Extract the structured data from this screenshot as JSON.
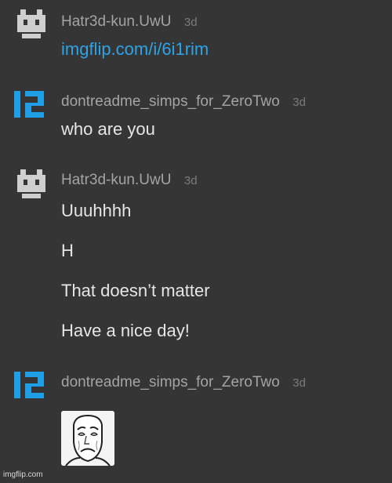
{
  "comments": [
    {
      "username": "Hatr3d-kun.UwU",
      "time": "3d",
      "avatar_icon": "pixel-robot-icon",
      "lines": [
        "imgflip.com/i/6i1rim"
      ]
    },
    {
      "username": "dontreadme_simps_for_ZeroTwo",
      "time": "3d",
      "avatar_icon": "pixel-blue-logo-icon",
      "lines": [
        "who are you"
      ]
    },
    {
      "username": "Hatr3d-kun.UwU",
      "time": "3d",
      "avatar_icon": "pixel-robot-icon",
      "lines": [
        "Uuuhhhh",
        "H",
        "That doesn’t matter",
        "Have a nice day!"
      ]
    },
    {
      "username": "dontreadme_simps_for_ZeroTwo",
      "time": "3d",
      "avatar_icon": "pixel-blue-logo-icon",
      "image": "sad-meme-face-image"
    }
  ],
  "watermark": "imgflip.com",
  "colors": {
    "background": "#353535",
    "username": "#a4a4a4",
    "link": "#2fa3e6",
    "text": "#e6e6e6",
    "avatar_blue": "#1e9fe8",
    "avatar_gray": "#cfcfcf"
  }
}
